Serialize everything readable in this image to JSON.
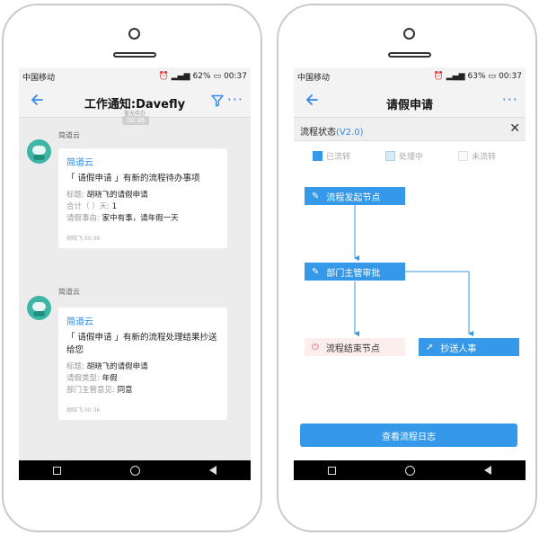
{
  "left": {
    "status": {
      "carrier": "中国移动",
      "battery": "62%",
      "time": "00:37"
    },
    "nav": {
      "title": "工作通知:Davefly",
      "subtitle": "暂无待办"
    },
    "time_pill": "00:36",
    "messages": [
      {
        "sender": "简道云",
        "app": "简道云",
        "title": "「 请假申请 」有新的流程待办事项",
        "lines": [
          {
            "k": "标题: ",
            "v": "胡晓飞的请假申请"
          },
          {
            "k": "合计（ ）天: ",
            "v": "1"
          },
          {
            "k": "请假事由: ",
            "v": "家中有事，请年假一天"
          }
        ],
        "footer": "胡晓飞 00:36"
      },
      {
        "sender": "简道云",
        "app": "简道云",
        "title": "「 请假申请 」有新的流程处理结果抄送给您",
        "lines": [
          {
            "k": "标题: ",
            "v": "胡晓飞的请假申请"
          },
          {
            "k": "请假类型: ",
            "v": "年假"
          },
          {
            "k": "部门主管意见: ",
            "v": "同意"
          }
        ],
        "footer": "胡晓飞 00:36"
      }
    ]
  },
  "right": {
    "status": {
      "carrier": "中国移动",
      "battery": "63%",
      "time": "00:37"
    },
    "nav": {
      "title": "请假申请"
    },
    "flow": {
      "title": "流程状态",
      "version": "(V2.0)",
      "legend": {
        "done": "已流转",
        "processing": "处理中",
        "not": "未流转"
      },
      "nodes": {
        "start": "流程发起节点",
        "manager": "部门主管审批",
        "end": "流程结束节点",
        "cc": "抄送人事"
      },
      "log_button": "查看流程日志"
    }
  },
  "colors": {
    "accent": "#3598e8",
    "link": "#2f8bf0",
    "avatar": "#3fb6a5",
    "end_icon": "#e95454"
  }
}
